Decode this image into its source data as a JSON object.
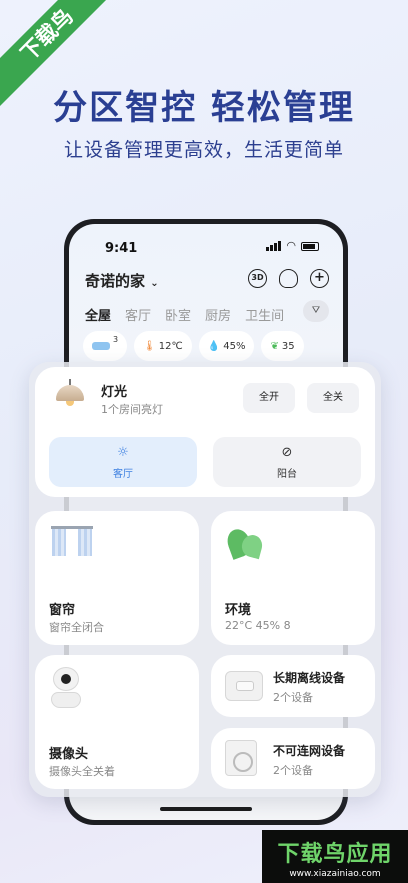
{
  "banner": {
    "ribbon": "下载鸟",
    "headline": "分区智控 轻松管理",
    "subline": "让设备管理更高效，生活更简单"
  },
  "status_bar": {
    "time": "9:41"
  },
  "home": {
    "title": "奇诺的家",
    "actions": {
      "view3d": "3D"
    },
    "rooms": [
      "全屋",
      "客厅",
      "卧室",
      "厨房",
      "卫生间"
    ],
    "chips": [
      {
        "icon": "ac-icon",
        "value": "",
        "badge": "3"
      },
      {
        "icon": "thermometer-icon",
        "value": "12℃"
      },
      {
        "icon": "humidity-icon",
        "value": "45%"
      },
      {
        "icon": "leaf-icon",
        "value": "35"
      }
    ]
  },
  "lights": {
    "title": "灯光",
    "subtitle": "1个房间亮灯",
    "all_on": "全开",
    "all_off": "全关",
    "rooms": [
      {
        "label": "客厅",
        "state": "on"
      },
      {
        "label": "阳台",
        "state": "off"
      }
    ]
  },
  "tiles": {
    "curtain": {
      "title": "窗帘",
      "sub": "窗帘全闭合"
    },
    "environment": {
      "title": "环境",
      "sub": "22°C 45% 8"
    },
    "camera": {
      "title": "摄像头",
      "sub": "摄像头全关着"
    },
    "offline": {
      "title": "长期离线设备",
      "sub": "2个设备"
    },
    "unconnectable": {
      "title": "不可连网设备",
      "sub": "2个设备"
    }
  },
  "watermark": {
    "main": "下载鸟应用",
    "sub": "www.xiazainiao.com"
  },
  "colors": {
    "accent": "#3c7fe0",
    "headline": "#2a3f93",
    "ribbon": "#3aa64f"
  }
}
